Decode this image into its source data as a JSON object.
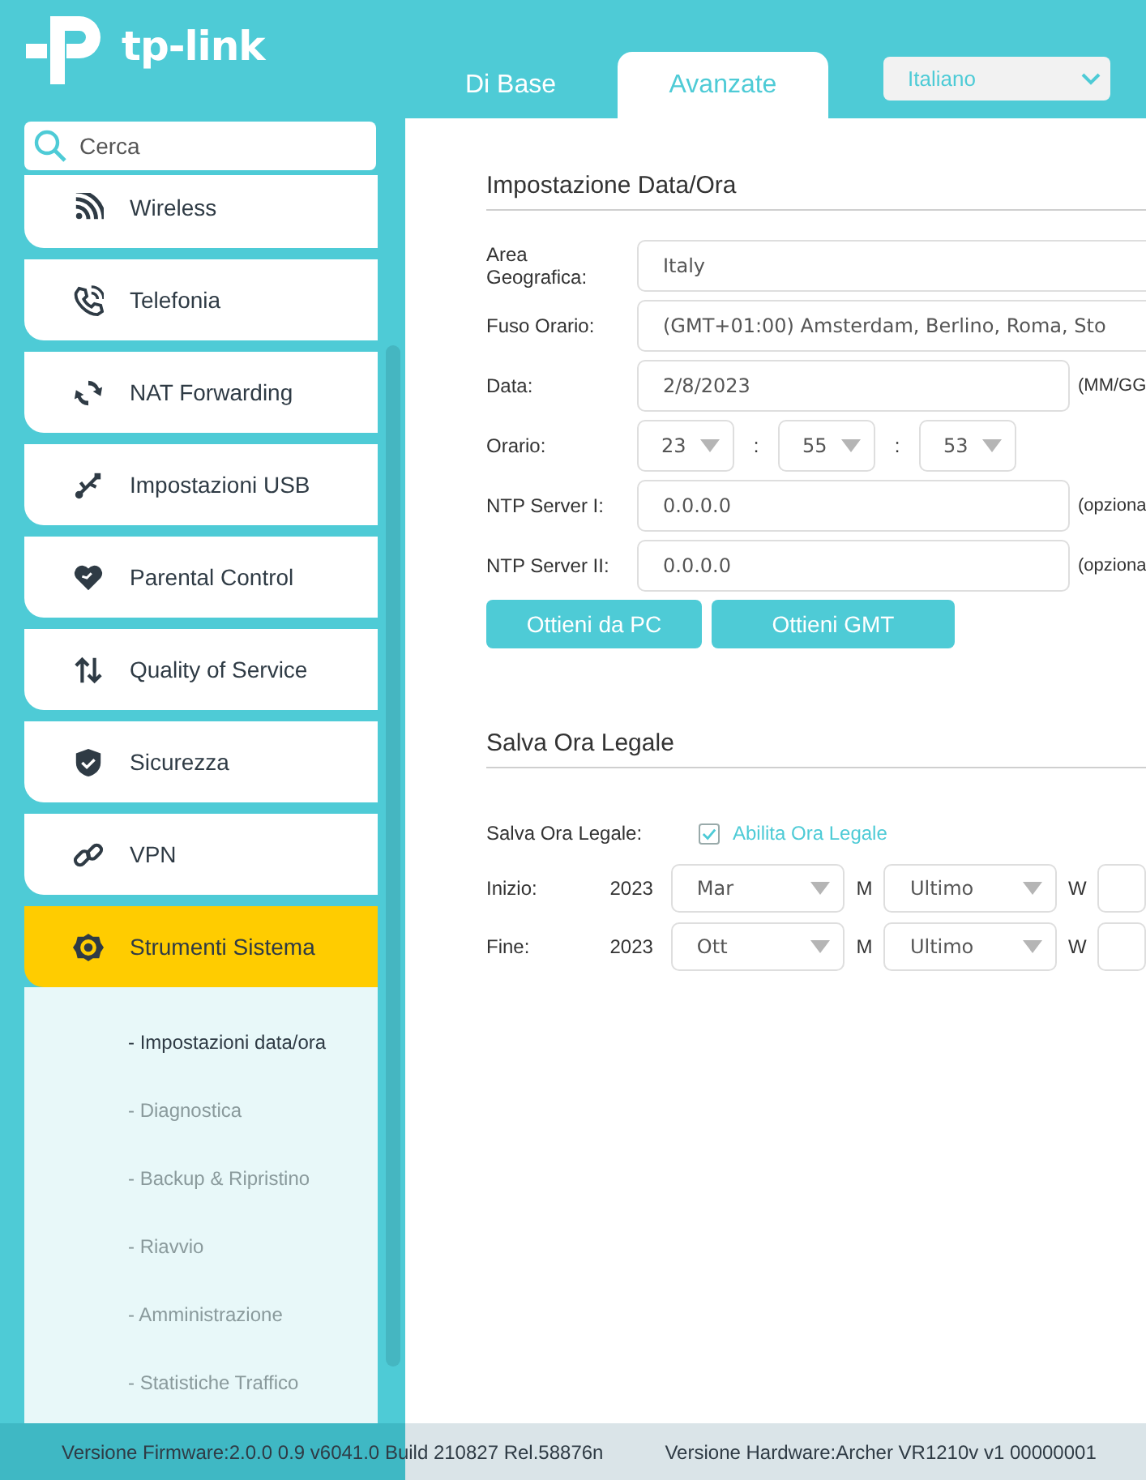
{
  "header": {
    "logo": "tp-link",
    "tabs": [
      {
        "label": "Di Base",
        "selected": false
      },
      {
        "label": "Avanzate",
        "selected": true
      }
    ],
    "language": "Italiano"
  },
  "sidebar": {
    "search": {
      "placeholder": "Cerca"
    },
    "items": [
      {
        "label": "Wireless",
        "selected": false
      },
      {
        "label": "Telefonia",
        "selected": false
      },
      {
        "label": "NAT Forwarding",
        "selected": false
      },
      {
        "label": "Impostazioni USB",
        "selected": false
      },
      {
        "label": "Parental Control",
        "selected": false
      },
      {
        "label": "Quality of Service",
        "selected": false
      },
      {
        "label": "Sicurezza",
        "selected": false
      },
      {
        "label": "VPN",
        "selected": false
      },
      {
        "label": "Strumenti Sistema",
        "selected": true,
        "children": [
          {
            "label": "- Impostazioni data/ora",
            "selected": true
          },
          {
            "label": "- Diagnostica",
            "selected": false
          },
          {
            "label": "- Backup & Ripristino",
            "selected": false
          },
          {
            "label": "- Riavvio",
            "selected": false
          },
          {
            "label": "- Amministrazione",
            "selected": false
          },
          {
            "label": "- Statistiche Traffico",
            "selected": false
          }
        ]
      }
    ]
  },
  "time_settings": {
    "title": "Impostazione Data/Ora",
    "rows": [
      {
        "kind": "select",
        "label": "Area Geografica:",
        "value": "Italy"
      },
      {
        "kind": "select",
        "label": "Fuso Orario:",
        "value": "(GMT+01:00) Amsterdam, Berlino, Roma, Sto"
      },
      {
        "kind": "input",
        "label": "Data:",
        "value": "2/8/2023",
        "hint": "(MM/GG"
      },
      {
        "kind": "time",
        "label": "Orario:",
        "values": [
          "23",
          "55",
          "53"
        ],
        "separators": [
          ":",
          ":"
        ]
      },
      {
        "kind": "input",
        "label": "NTP Server I:",
        "value": "0.0.0.0",
        "hint": "(opziona"
      },
      {
        "kind": "input",
        "label": "NTP Server II:",
        "value": "0.0.0.0",
        "hint": "(opziona"
      }
    ],
    "buttons": [
      "Ottieni da PC",
      "Ottieni GMT"
    ]
  },
  "dst": {
    "title": "Salva Ora Legale",
    "label": "Salva Ora Legale:",
    "option": "Abilita Ora Legale",
    "checked": true,
    "rows": [
      {
        "label": "Inizio:",
        "year": "2023",
        "month": "Mar",
        "month_unit": "M",
        "week": "Ultimo",
        "week_unit": "W"
      },
      {
        "label": "Fine:",
        "year": "2023",
        "month": "Ott",
        "month_unit": "M",
        "week": "Ultimo",
        "week_unit": "W"
      }
    ]
  },
  "status_bar": {
    "firmware": "Versione Firmware:2.0.0 0.9 v6041.0 Build 210827 Rel.58876n",
    "hardware": "Versione Hardware:Archer VR1210v v1 00000001"
  }
}
